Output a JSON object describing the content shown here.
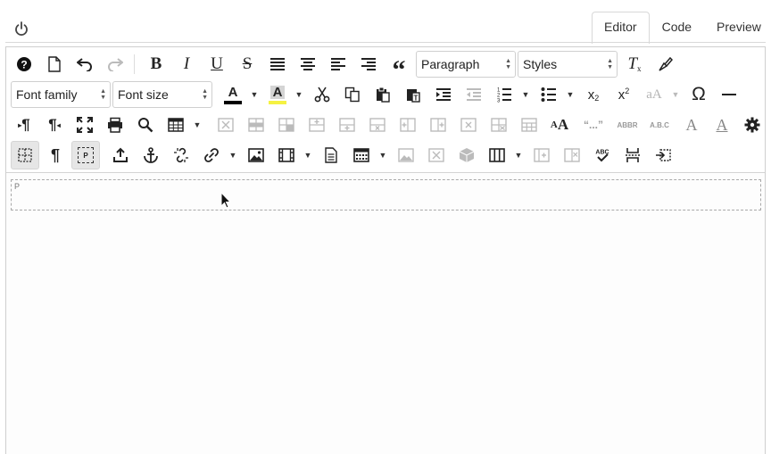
{
  "tabs": {
    "editor": "Editor",
    "code": "Code",
    "preview": "Preview"
  },
  "toolbar": {
    "block_format": "Paragraph",
    "styles": "Styles",
    "font_family": "Font family",
    "font_size": "Font size",
    "text_color_letter": "A",
    "highlight_letter": "A",
    "highlight_color": "#f5f242",
    "text_color": "#000000",
    "abbr": "ABBR",
    "acronym": "A.B.C",
    "quote_glyph": "“...”",
    "omega": "Ω",
    "font_case": "aA",
    "p_badge": "P"
  },
  "content": {
    "block_label": "P"
  }
}
